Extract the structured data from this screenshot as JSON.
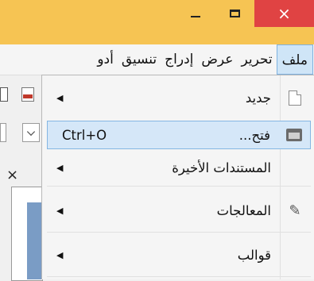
{
  "window": {
    "minimize_glyph": "minimize-icon",
    "maximize_glyph": "maximize-icon",
    "close_label": "×"
  },
  "menubar": {
    "items": [
      "ملف",
      "تحرير",
      "عرض",
      "إدراج",
      "تنسيق",
      "أدو"
    ]
  },
  "left_pane": {
    "close_label": "×"
  },
  "file_menu": {
    "new": {
      "label": "جديد",
      "icon": "new-document-icon"
    },
    "open": {
      "label": "فتح...",
      "shortcut": "Ctrl+O",
      "icon": "folder-open-icon"
    },
    "recent": {
      "label": "المستندات الأخيرة"
    },
    "wizards": {
      "label": "المعالجات",
      "icon": "wizard-wand-icon"
    },
    "templates": {
      "label": "قوالب"
    }
  },
  "colors": {
    "titlebar": "#f6c453",
    "close_button": "#e04343",
    "highlight": "#d5e7f8",
    "highlight_border": "#84b6e3"
  }
}
